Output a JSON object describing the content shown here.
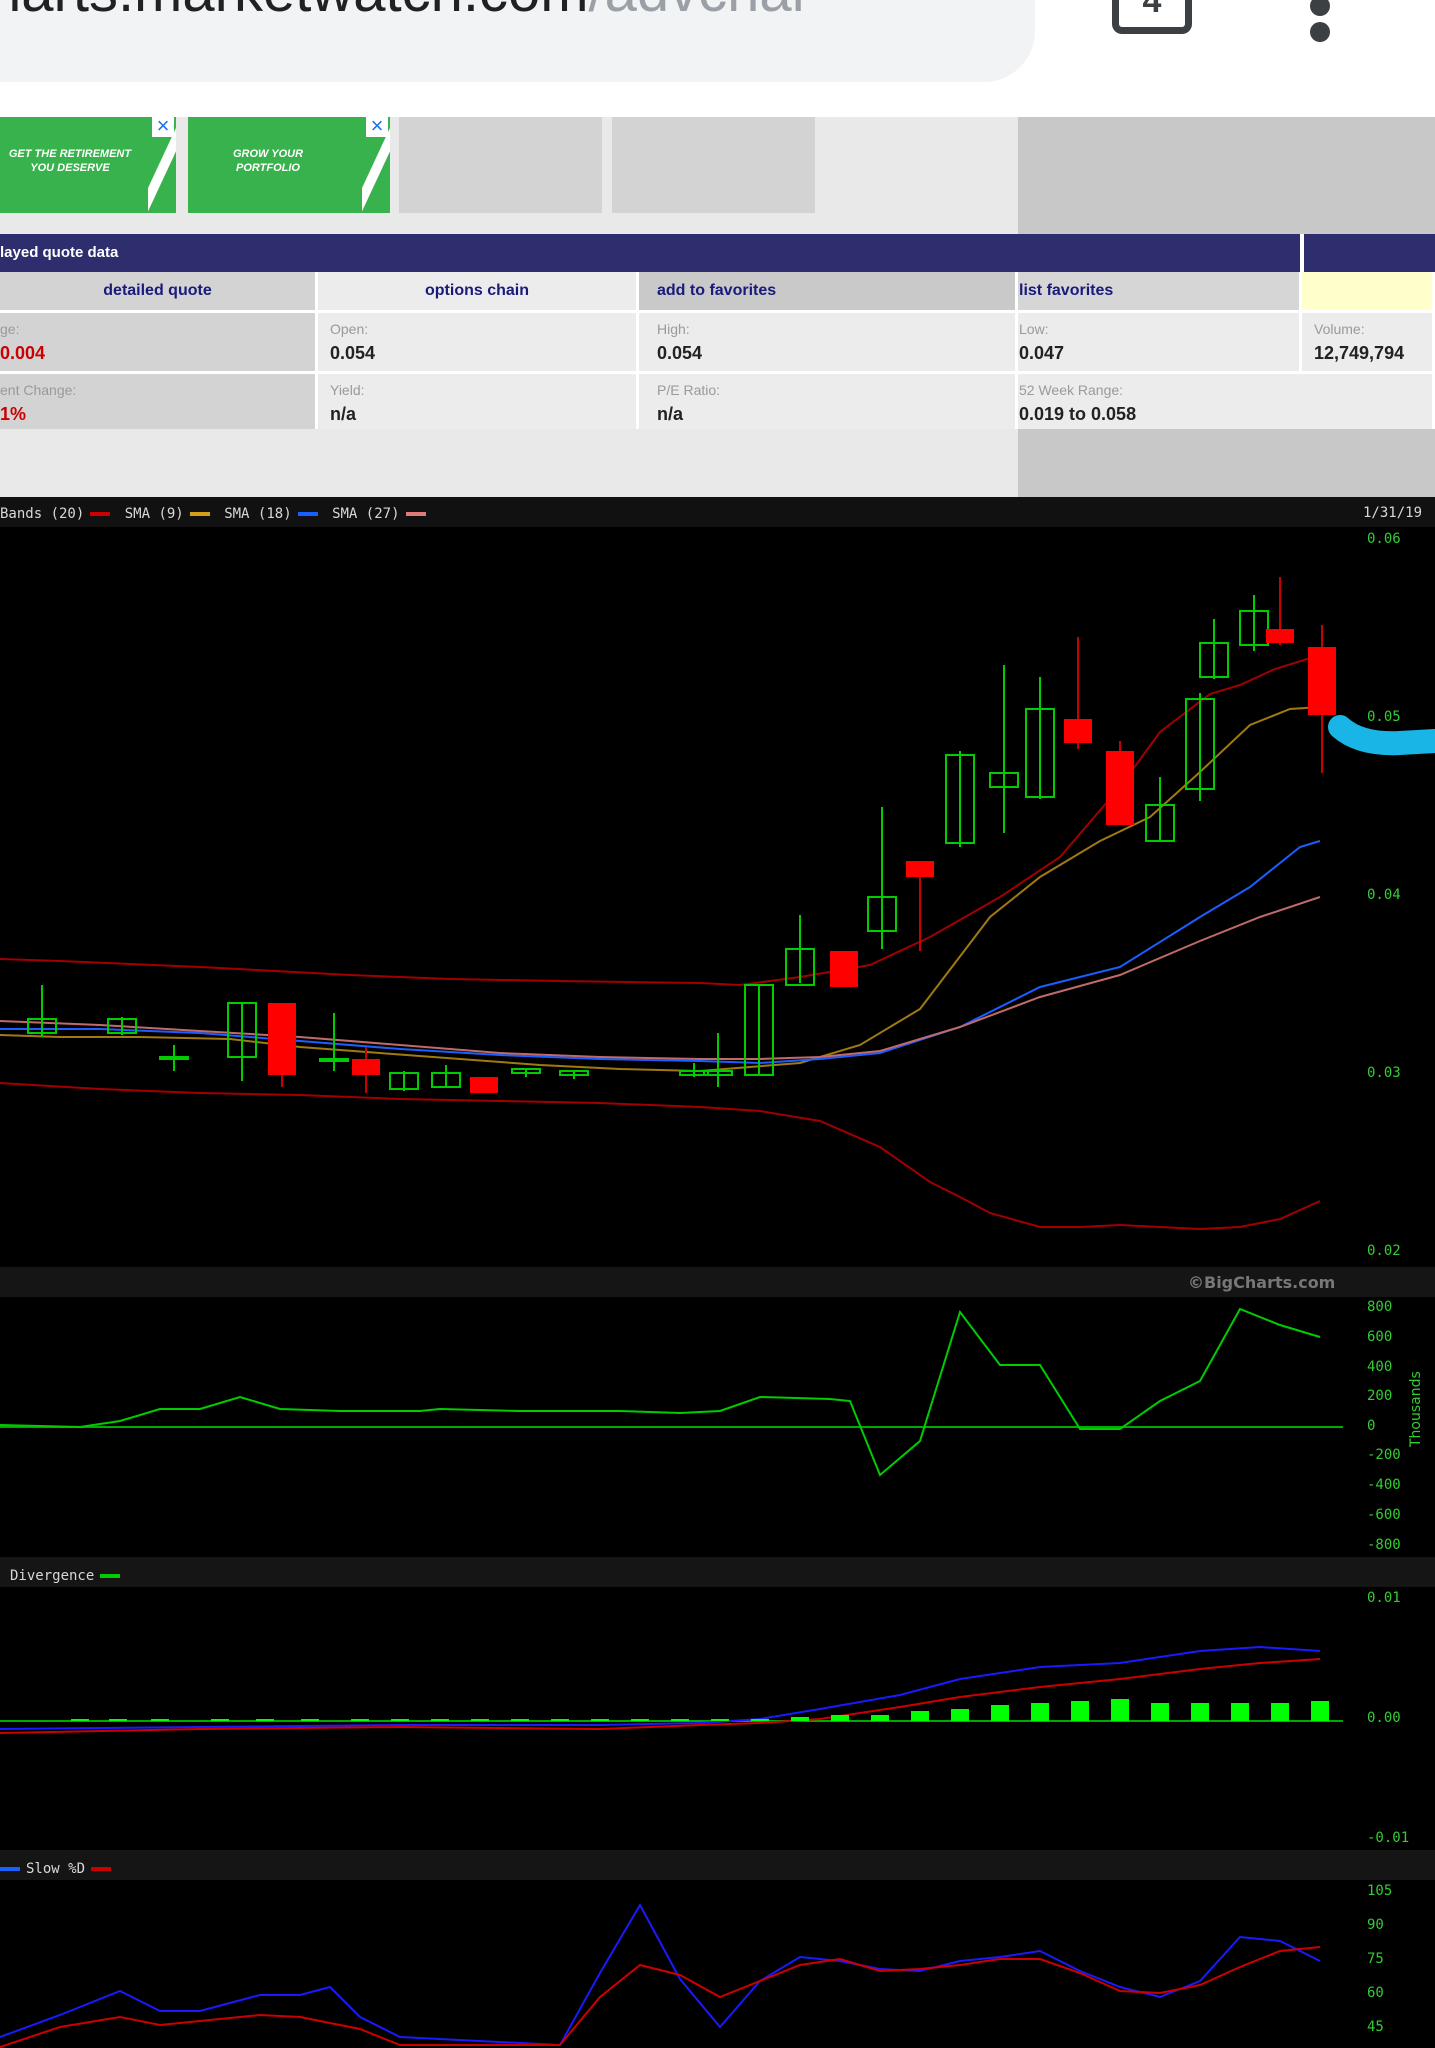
{
  "browser": {
    "url_domain": "charts.marketwatch.com",
    "url_path": "/advchar",
    "tab_count": "4",
    "menu_icon": "vertical-dots-icon"
  },
  "ads": [
    {
      "text": "GET THE RETIREMENT YOU DESERVE"
    },
    {
      "text": "GROW YOUR PORTFOLIO"
    }
  ],
  "quote": {
    "header": "layed quote data",
    "links": [
      "detailed quote",
      "options chain",
      "add to favorites",
      "list favorites"
    ],
    "row1": [
      {
        "label": "ge:",
        "value": "0.004",
        "red": true
      },
      {
        "label": "Open:",
        "value": "0.054"
      },
      {
        "label": "High:",
        "value": "0.054"
      },
      {
        "label": "Low:",
        "value": "0.047"
      },
      {
        "label": "Volume:",
        "value": "12,749,794"
      }
    ],
    "row2": [
      {
        "label": "ent Change:",
        "value": "1%",
        "red": true
      },
      {
        "label": "Yield:",
        "value": "n/a"
      },
      {
        "label": "P/E Ratio:",
        "value": "n/a"
      },
      {
        "label": "52 Week Range:",
        "value": "0.019 to 0.058"
      }
    ]
  },
  "chart": {
    "legend_main": [
      {
        "text": "Bands (20)",
        "color": "#cc0000"
      },
      {
        "text": "SMA (9)",
        "color": "#d4a017"
      },
      {
        "text": "SMA (18)",
        "color": "#1a5fff"
      },
      {
        "text": "SMA (27)",
        "color": "#e07a7a"
      }
    ],
    "date": "1/31/19",
    "price_ticks": [
      "0.06",
      "0.05",
      "0.04",
      "0.03",
      "0.02"
    ],
    "credit": "©BigCharts.com",
    "vol_ticks": [
      "800",
      "600",
      "400",
      "200",
      "0",
      "-200",
      "-400",
      "-600",
      "-800"
    ],
    "vol_unit": "Thousands",
    "macd_legend": "Divergence",
    "macd_ticks": [
      "0.01",
      "0.00",
      "-0.01"
    ],
    "stoch_legend": "Slow %D",
    "stoch_ticks": [
      "105",
      "90",
      "75",
      "60",
      "45"
    ]
  }
}
